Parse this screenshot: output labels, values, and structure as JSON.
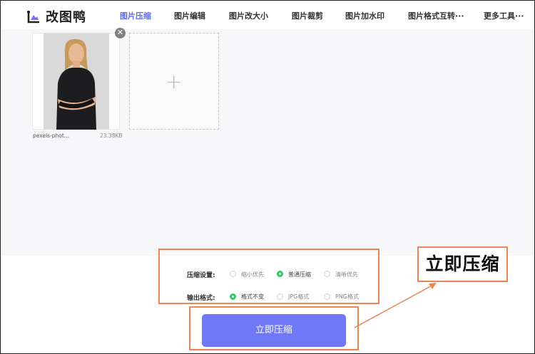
{
  "header": {
    "logo_text": "改图鸭",
    "nav": [
      {
        "label": "图片压缩",
        "active": true
      },
      {
        "label": "图片编辑",
        "active": false
      },
      {
        "label": "图片改大小",
        "active": false
      },
      {
        "label": "图片裁剪",
        "active": false
      },
      {
        "label": "图片加水印",
        "active": false
      },
      {
        "label": "图片格式互转···",
        "active": false
      },
      {
        "label": "更多工具···",
        "active": false
      }
    ]
  },
  "upload": {
    "file_name": "pexels-phot...",
    "file_size": "23.38KB",
    "add_symbol": "+",
    "close_symbol": "✕"
  },
  "settings": {
    "compress_label": "压缩设置:",
    "compress_options": [
      {
        "label": "缩小优先",
        "selected": false
      },
      {
        "label": "普通压缩",
        "selected": true
      },
      {
        "label": "清晰优先",
        "selected": false
      }
    ],
    "format_label": "输出格式:",
    "format_options": [
      {
        "label": "格式不变",
        "selected": true
      },
      {
        "label": "JPG格式",
        "selected": false
      },
      {
        "label": "PNG格式",
        "selected": false
      }
    ]
  },
  "action": {
    "compress_button": "立即压缩"
  },
  "annotation": {
    "text": "立即压缩"
  },
  "colors": {
    "accent": "#5b6cf0",
    "button": "#6f78f6",
    "radio_selected": "#35c46b",
    "annotation": "#ec8554"
  },
  "icons": {
    "logo": "duck-logo-icon",
    "close": "close-icon",
    "add": "plus-icon"
  }
}
